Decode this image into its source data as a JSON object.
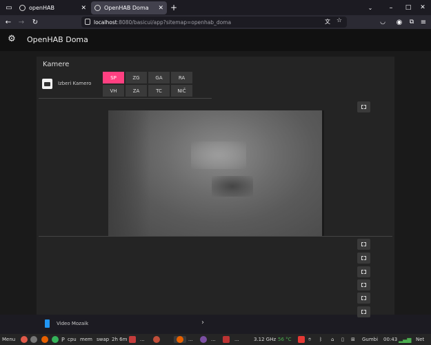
{
  "browser": {
    "tabs": [
      {
        "title": "openHAB",
        "active": false
      },
      {
        "title": "OpenHAB Doma",
        "active": true
      }
    ],
    "new_tab_glyph": "+",
    "url": {
      "host": "localhost",
      "rest": ":8080/basicui/app?sitemap=openhab_doma"
    }
  },
  "app": {
    "title": "OpenHAB Doma",
    "icon": "gear-icon"
  },
  "frame": {
    "title": "Kamere",
    "camera_selector": {
      "label": "Izberi Kamero",
      "options": [
        "SP",
        "ZG",
        "GA",
        "RA",
        "VH",
        "ZA",
        "TC",
        "NIČ"
      ],
      "selected": "SP"
    },
    "accent_color": "#ff4081",
    "mosaic": {
      "label": "Video Mozaik",
      "chevron": "›"
    }
  },
  "taskbar": {
    "menu_label": "Menu",
    "cpu_label": "cpu",
    "mem_label": "mem",
    "swap_label": "swap",
    "uptime": "2h 6m",
    "freq": "3.12 GHz",
    "temp": "56 °C",
    "user": "Gumbi",
    "clock": "00:43",
    "net_label": "Net"
  }
}
